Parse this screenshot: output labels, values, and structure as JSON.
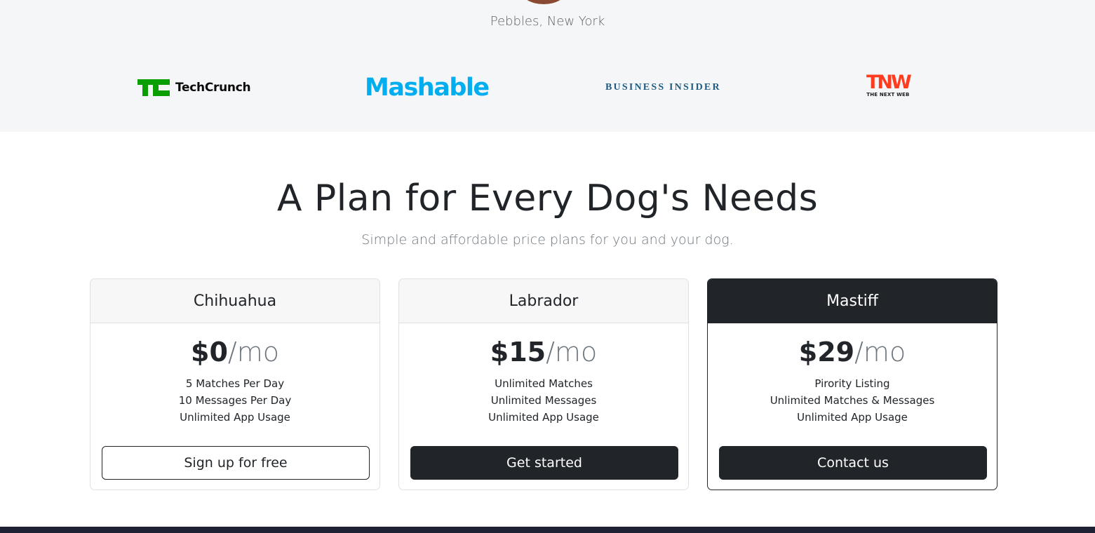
{
  "testimonial": {
    "author": "Pebbles, New York"
  },
  "press_logos": [
    {
      "name": "TechCrunch",
      "text": "TechCrunch",
      "color": "#0a9e01"
    },
    {
      "name": "Mashable",
      "text": "Mashable",
      "color": "#00aeef"
    },
    {
      "name": "Business Insider",
      "text": "BUSINESS INSIDER",
      "color": "#1f5c80"
    },
    {
      "name": "The Next Web",
      "text": "TNW",
      "subtext": "THE NEXT WEB",
      "color": "#ff3c1f"
    }
  ],
  "pricing": {
    "title": "A Plan for Every Dog's Needs",
    "subtitle": "Simple and affordable price plans for you and your dog.",
    "plans": [
      {
        "name": "Chihuahua",
        "price": "$0",
        "period": "/mo",
        "features": [
          "5 Matches Per Day",
          "10 Messages Per Day",
          "Unlimited App Usage"
        ],
        "button": "Sign up for free",
        "style": "outline"
      },
      {
        "name": "Labrador",
        "price": "$15",
        "period": "/mo",
        "features": [
          "Unlimited Matches",
          "Unlimited Messages",
          "Unlimited App Usage"
        ],
        "button": "Get started",
        "style": "dark"
      },
      {
        "name": "Mastiff",
        "price": "$29",
        "period": "/mo",
        "features": [
          "Pirority Listing",
          "Unlimited Matches & Messages",
          "Unlimited App Usage"
        ],
        "button": "Contact us",
        "style": "dark",
        "featured": true
      }
    ]
  },
  "colors": {
    "dark": "#212529",
    "muted": "#6c757d",
    "press_bg": "#f5f6f8"
  }
}
